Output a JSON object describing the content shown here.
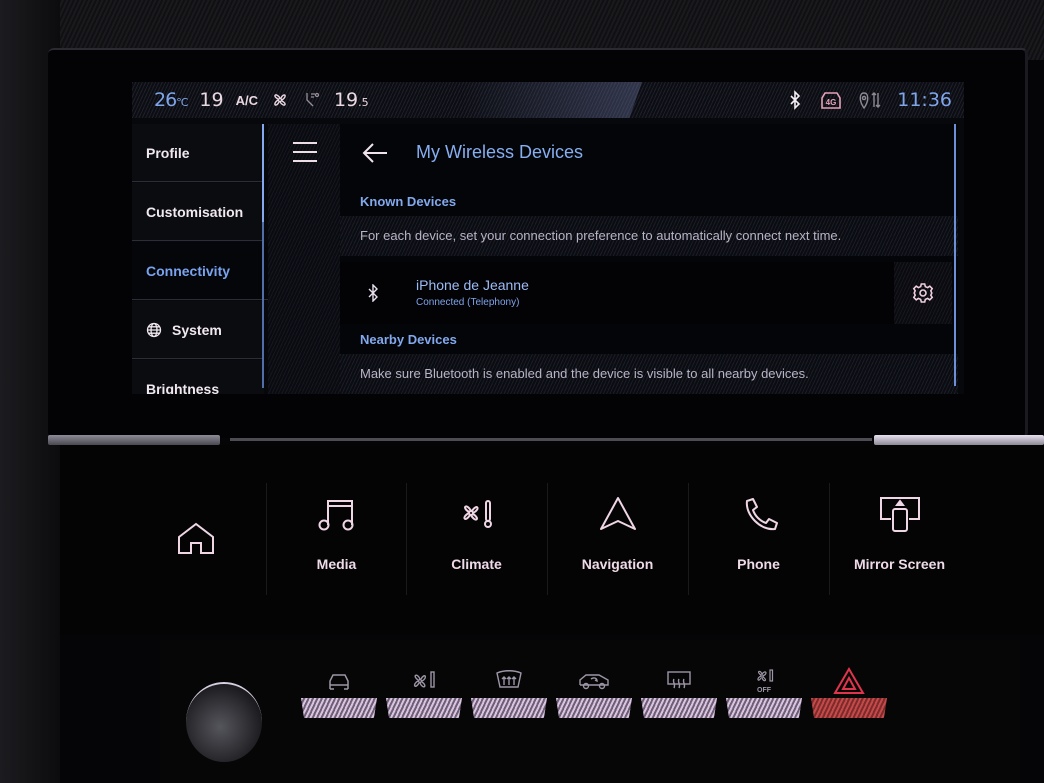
{
  "status_bar": {
    "exterior_temp_value": "26",
    "exterior_temp_unit": "°C",
    "driver_temp_value": "19",
    "ac_label": "A/C",
    "fan_icon": "fan-icon",
    "seat_airflow_icon": "seat-airflow-icon",
    "passenger_temp_value": "19",
    "passenger_temp_decimal": ".5",
    "bluetooth_icon": "bluetooth-icon",
    "network_badge": "4G",
    "location_icon": "location-data-icon",
    "clock": "11:36"
  },
  "sidebar": {
    "items": [
      {
        "label": "Profile",
        "active": false
      },
      {
        "label": "Customisation",
        "active": false
      },
      {
        "label": "Connectivity",
        "active": true
      },
      {
        "label": "System",
        "icon": "globe-icon",
        "active": false
      },
      {
        "label": "Brightness",
        "active": false
      }
    ]
  },
  "content": {
    "title": "My Wireless Devices",
    "known_devices": {
      "heading": "Known Devices",
      "description": "For each device, set your connection preference to automatically connect next time.",
      "devices": [
        {
          "name": "iPhone de Jeanne",
          "status": "Connected (Telephony)",
          "icon": "bluetooth-connected-icon"
        }
      ]
    },
    "nearby_devices": {
      "heading": "Nearby Devices",
      "description": "Make sure Bluetooth is enabled and the device is visible to all nearby devices."
    }
  },
  "touch_bar": {
    "home_icon": "home-icon",
    "buttons": [
      {
        "label": "Media",
        "icon": "music-note-icon"
      },
      {
        "label": "Climate",
        "icon": "fan-thermometer-icon"
      },
      {
        "label": "Navigation",
        "icon": "navigation-arrow-icon"
      },
      {
        "label": "Phone",
        "icon": "phone-icon"
      },
      {
        "label": "Mirror Screen",
        "icon": "mirror-screen-icon"
      }
    ]
  },
  "hardware_keys": [
    {
      "icon": "car-front-icon"
    },
    {
      "icon": "climate-icon"
    },
    {
      "icon": "front-defrost-icon"
    },
    {
      "icon": "recirculation-icon"
    },
    {
      "icon": "rear-defrost-icon"
    },
    {
      "icon": "climate-off-icon",
      "label": "OFF"
    },
    {
      "icon": "hazard-icon"
    }
  ],
  "colors": {
    "accent_blue": "#86aef0",
    "text_pink": "#efdbe8",
    "hazard_red": "#e0344c"
  }
}
